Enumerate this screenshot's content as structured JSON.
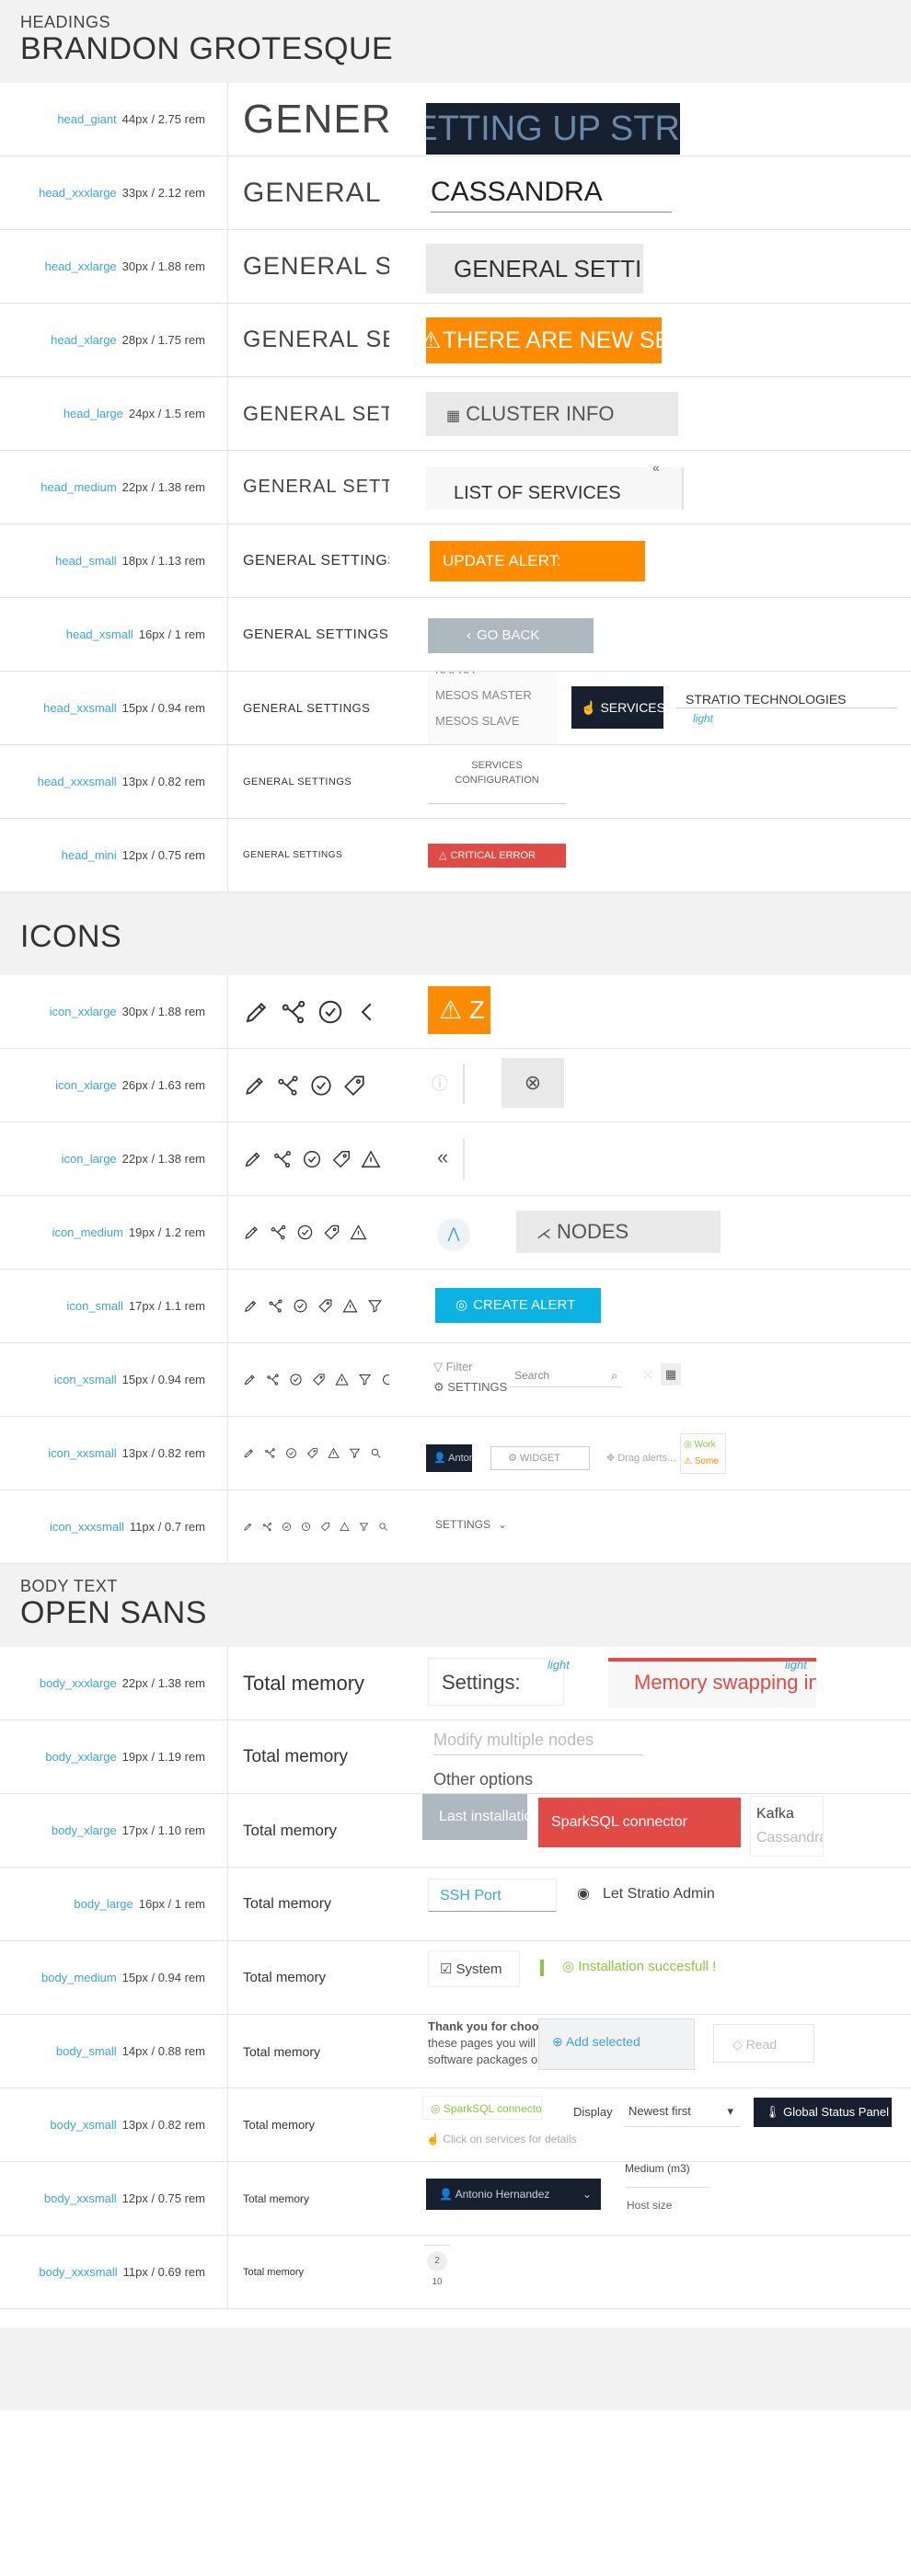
{
  "headings": {
    "section_small": "HEADINGS",
    "section_big": "BRANDON GROTESQUE",
    "sample": "GENERAL SETTINGS",
    "rows": [
      {
        "name": "head_giant",
        "size": "44px / 2.75 rem",
        "sample": "GENERAL SETTINGS",
        "demo": "SETTING UP STRATIO"
      },
      {
        "name": "head_xxxlarge",
        "size": "33px / 2.12 rem",
        "sample": "GENERAL SETTINGS",
        "demo": "CASSANDRA"
      },
      {
        "name": "head_xxlarge",
        "size": "30px / 1.88 rem",
        "sample": "GENERAL SETTINGS",
        "demo": "GENERAL SETTINGS"
      },
      {
        "name": "head_xlarge",
        "size": "28px / 1.75 rem",
        "sample": "GENERAL SETTINGS",
        "demo": "THERE ARE NEW SERVICES"
      },
      {
        "name": "head_large",
        "size": "24px / 1.5 rem",
        "sample": "GENERAL SETTINGS",
        "demo": "CLUSTER INFO"
      },
      {
        "name": "head_medium",
        "size": "22px / 1.38 rem",
        "sample": "GENERAL SETTINGS",
        "demo": "LIST OF SERVICES"
      },
      {
        "name": "head_small",
        "size": "18px / 1.13 rem",
        "sample": "GENERAL SETTINGS",
        "demo": "UPDATE ALERT:"
      },
      {
        "name": "head_xsmall",
        "size": "16px / 1 rem",
        "sample": "GENERAL SETTINGS",
        "demo": "GO BACK"
      },
      {
        "name": "head_xxsmall",
        "size": "15px / 0.94 rem",
        "sample": "GENERAL SETTINGS",
        "demo_list": [
          "KAFKA",
          "MESOS MASTER",
          "MESOS SLAVE"
        ],
        "demo_services": "SERVICES",
        "demo_company": "STRATIO TECHNOLOGIES",
        "demo_light": "light"
      },
      {
        "name": "head_xxxsmall",
        "size": "13px / 0.82 rem",
        "sample": "GENERAL SETTINGS",
        "demo_line1": "SERVICES",
        "demo_line2": "CONFIGURATION"
      },
      {
        "name": "head_mini",
        "size": "12px / 0.75 rem",
        "sample": "GENERAL SETTINGS",
        "demo": "CRITICAL ERROR"
      }
    ]
  },
  "icons": {
    "section_big": "ICONS",
    "rows": [
      {
        "name": "icon_xxlarge",
        "size": "30px / 1.88 rem"
      },
      {
        "name": "icon_xlarge",
        "size": "26px / 1.63 rem"
      },
      {
        "name": "icon_large",
        "size": "22px / 1.38 rem"
      },
      {
        "name": "icon_medium",
        "size": "19px / 1.2 rem",
        "demo": "NODES"
      },
      {
        "name": "icon_small",
        "size": "17px / 1.1 rem",
        "demo": "CREATE ALERT"
      },
      {
        "name": "icon_xsmall",
        "size": "15px / 0.94 rem",
        "demo_filter": "Filter",
        "demo_settings": "SETTINGS",
        "demo_search": "Search"
      },
      {
        "name": "icon_xxsmall",
        "size": "13px / 0.82 rem",
        "demo_user": "Antonio",
        "demo_widget": "WIDGET",
        "demo_drag": "Drag alerts...",
        "demo_work": "Work",
        "demo_some": "Some"
      },
      {
        "name": "icon_xxxsmall",
        "size": "11px / 0.7 rem",
        "demo": "SETTINGS"
      }
    ]
  },
  "body": {
    "section_small": "BODY TEXT",
    "section_big": "OPEN SANS",
    "rows": [
      {
        "name": "body_xxxlarge",
        "size": "22px / 1.38 rem",
        "sample": "Total memory",
        "demo_settings": "Settings:",
        "demo_light": "light",
        "demo_memory": "Memory swapping in",
        "demo_light2": "light"
      },
      {
        "name": "body_xxlarge",
        "size": "19px / 1.19 rem",
        "sample": "Total memory",
        "demo_placeholder": "Modify multiple nodes",
        "demo_other": "Other options"
      },
      {
        "name": "body_xlarge",
        "size": "17px / 1.10 rem",
        "sample": "Total memory",
        "demo_last": "Last installation",
        "demo_sparksql": "SparkSQL connector",
        "demo_kafka": "Kafka",
        "demo_cassandra": "Cassandra"
      },
      {
        "name": "body_large",
        "size": "16px / 1 rem",
        "sample": "Total memory",
        "demo_port": "SSH Port",
        "demo_radio": "Let Stratio Admin"
      },
      {
        "name": "body_medium",
        "size": "15px / 0.94 rem",
        "sample": "Total memory",
        "demo_system": "System",
        "demo_install": "Installation succesfull !"
      },
      {
        "name": "body_small",
        "size": "14px / 0.88 rem",
        "sample": "Total memory",
        "demo_thanks": "Thank you for choosing Stratio",
        "demo_pages": "these pages you will install the",
        "demo_software": "software packages on your",
        "demo_add": "Add selected",
        "demo_read": "Read"
      },
      {
        "name": "body_xsmall",
        "size": "13px / 0.82 rem",
        "sample": "Total memory",
        "demo_spark": "SparkSQL connector",
        "demo_click": "Click on services for details",
        "demo_display": "Display",
        "demo_newest": "Newest first",
        "demo_global": "Global Status Panel"
      },
      {
        "name": "body_xxsmall",
        "size": "12px / 0.75 rem",
        "sample": "Total memory",
        "demo_user": "Antonio Hernandez",
        "demo_medium": "Medium (m3)",
        "demo_host": "Host size"
      },
      {
        "name": "body_xxxsmall",
        "size": "11px / 0.69 rem",
        "sample": "Total memory",
        "demo_n1": "2",
        "demo_n2": "10"
      }
    ]
  },
  "colors": {
    "accent_blue": "#3aa5d8",
    "orange": "#ff8c00",
    "dark": "#16202e",
    "red": "#e14a45",
    "cyan": "#0bb3e2"
  }
}
